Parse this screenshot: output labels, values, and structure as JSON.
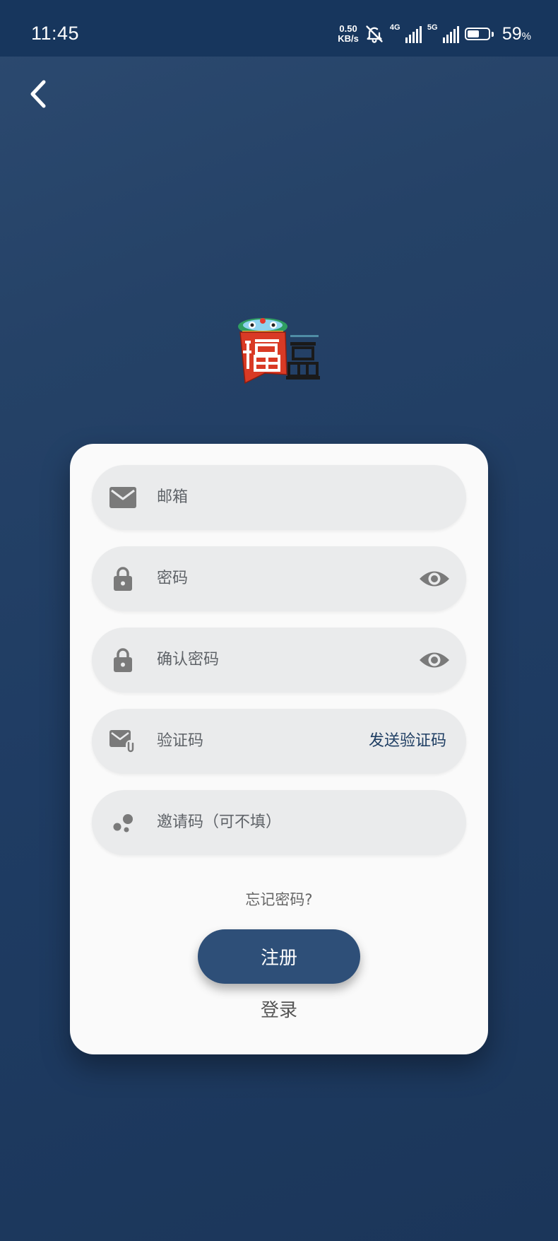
{
  "status_bar": {
    "time": "11:45",
    "net_speed_value": "0.50",
    "net_speed_unit": "KB/s",
    "sim1_type": "4G",
    "sim2_type": "5G",
    "battery_level": "59",
    "battery_unit": "%",
    "battery_fraction": 0.59
  },
  "form": {
    "email_placeholder": "邮箱",
    "password_placeholder": "密码",
    "confirm_password_placeholder": "确认密码",
    "code_placeholder": "验证码",
    "send_code_label": "发送验证码",
    "invite_placeholder": "邀请码（可不填）",
    "forgot_label": "忘记密码?",
    "register_label": "注册",
    "login_label": "登录"
  },
  "colors": {
    "primary": "#2e4f78",
    "background": "#1f3c63",
    "field_bg": "#eaebec",
    "icon_gray": "#7a7a7a"
  },
  "icons": {
    "back": "chevron-left-icon",
    "email": "envelope-icon",
    "password": "lock-icon",
    "visibility": "eye-icon",
    "code": "mail-attachment-icon",
    "invite": "dots-icon"
  }
}
